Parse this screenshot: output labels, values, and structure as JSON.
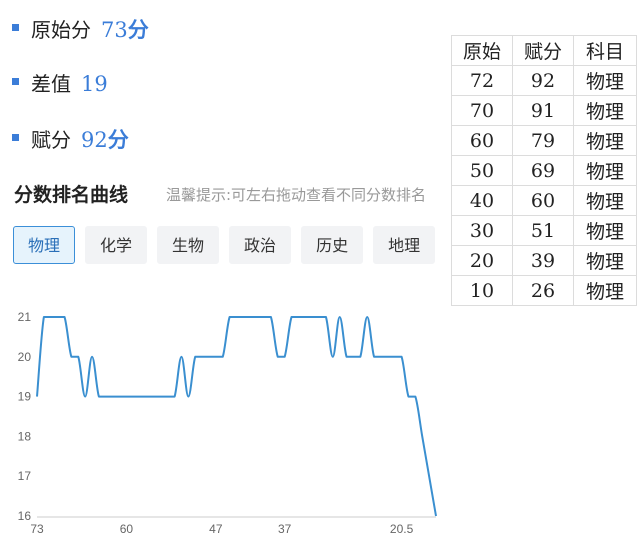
{
  "stats": [
    {
      "label": "原始分",
      "value": "73",
      "unit": "分"
    },
    {
      "label": "差值",
      "value": "19",
      "unit": ""
    },
    {
      "label": "赋分",
      "value": "92",
      "unit": "分"
    }
  ],
  "section_title": "分数排名曲线",
  "hint": "温馨提示:可左右拖动查看不同分数排名",
  "tabs": [
    {
      "label": "物理",
      "active": true
    },
    {
      "label": "化学",
      "active": false
    },
    {
      "label": "生物",
      "active": false
    },
    {
      "label": "政治",
      "active": false
    },
    {
      "label": "历史",
      "active": false
    },
    {
      "label": "地理",
      "active": false
    }
  ],
  "table": {
    "headers": [
      "原始",
      "赋分",
      "科目"
    ],
    "rows": [
      [
        "72",
        "92",
        "物理"
      ],
      [
        "70",
        "91",
        "物理"
      ],
      [
        "60",
        "79",
        "物理"
      ],
      [
        "50",
        "69",
        "物理"
      ],
      [
        "40",
        "60",
        "物理"
      ],
      [
        "30",
        "51",
        "物理"
      ],
      [
        "20",
        "39",
        "物理"
      ],
      [
        "10",
        "26",
        "物理"
      ]
    ]
  },
  "chart_data": {
    "type": "line",
    "color": "#3a8fd0",
    "x_tick_labels": [
      "73",
      "60",
      "47",
      "37",
      "20.5"
    ],
    "y_tick_labels": [
      "21",
      "20",
      "19",
      "18",
      "17",
      "16"
    ],
    "ylim": [
      16,
      21
    ],
    "grid": false,
    "x": [
      73,
      72,
      71,
      70,
      69,
      68,
      67,
      66,
      65,
      64,
      63,
      62,
      61,
      60,
      59,
      58,
      57,
      56,
      55,
      54,
      53,
      52,
      51,
      50,
      49,
      48,
      47,
      46,
      45,
      44,
      43,
      42,
      41,
      40,
      39,
      38,
      37,
      36,
      35,
      34,
      33,
      32,
      31,
      30,
      29,
      28,
      27,
      26,
      25,
      24,
      23,
      22,
      21,
      20.5,
      20,
      19.5,
      19,
      18.5,
      18
    ],
    "y": [
      19,
      21,
      21,
      21,
      21,
      20,
      20,
      19,
      20,
      19,
      19,
      19,
      19,
      19,
      19,
      19,
      19,
      19,
      19,
      19,
      19,
      20,
      19,
      20,
      20,
      20,
      20,
      20,
      21,
      21,
      21,
      21,
      21,
      21,
      21,
      20,
      20,
      21,
      21,
      21,
      21,
      21,
      21,
      20,
      21,
      20,
      20,
      20,
      21,
      20,
      20,
      20,
      20,
      20,
      19,
      19,
      18,
      17,
      16
    ]
  }
}
